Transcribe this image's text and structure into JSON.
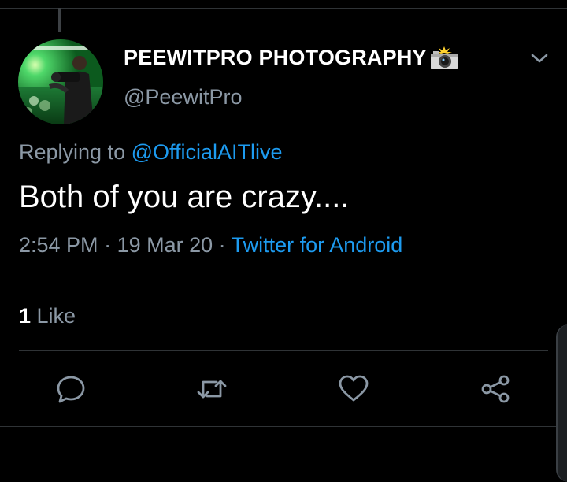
{
  "tweet": {
    "display_name": "PEEWITPRO PHOTOGRAPHY",
    "handle": "@PeewitPro",
    "replying_prefix": "Replying to ",
    "replying_to": "@OfficialAITlive",
    "text": "Both of you are crazy....",
    "time": "2:54 PM",
    "date": "19 Mar 20",
    "separator": " · ",
    "source": "Twitter for Android",
    "likes_count": "1",
    "likes_label": " Like"
  },
  "icons": {
    "name_emoji": "camera-with-flash-icon",
    "menu": "chevron-down-icon",
    "reply": "comment-icon",
    "retweet": "retweet-icon",
    "like": "heart-icon",
    "share": "share-icon"
  },
  "colors": {
    "background": "#000000",
    "primary_text": "#ffffff",
    "secondary_text": "#8b98a5",
    "link": "#1d9bf0",
    "divider": "#2f3336"
  }
}
